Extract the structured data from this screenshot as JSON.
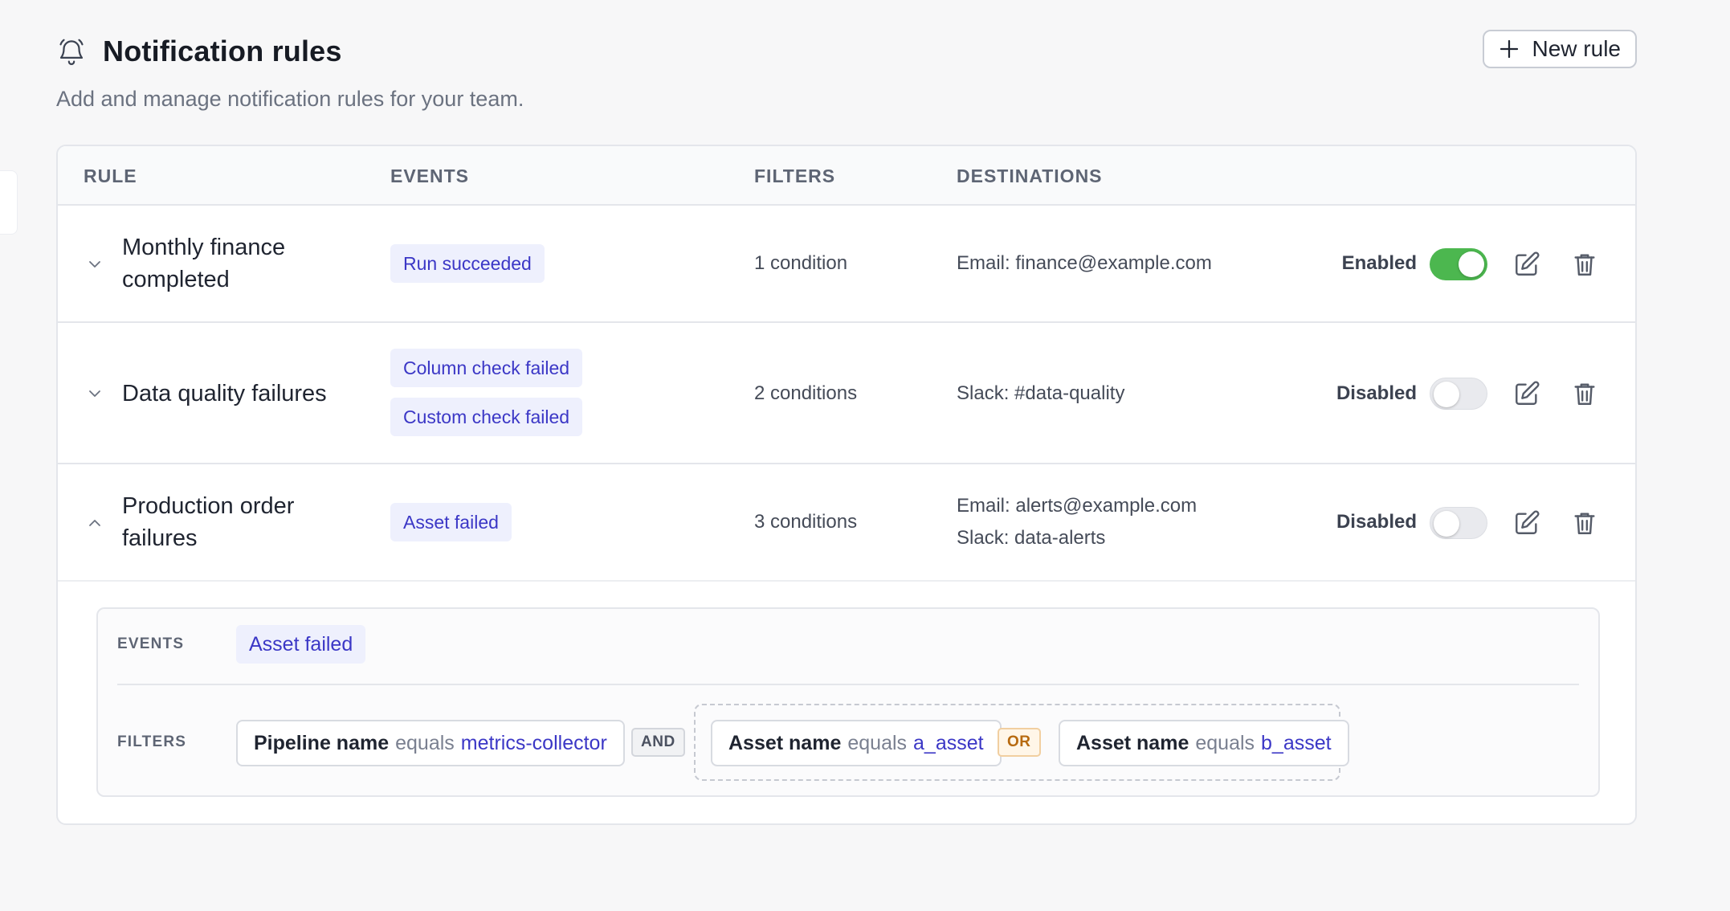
{
  "header": {
    "title": "Notification rules",
    "subtitle": "Add and manage notification rules for your team.",
    "new_rule_label": "New rule"
  },
  "table": {
    "columns": [
      "RULE",
      "EVENTS",
      "FILTERS",
      "DESTINATIONS"
    ],
    "rows": [
      {
        "name": "Monthly finance completed",
        "events": [
          "Run succeeded"
        ],
        "filters": "1 condition",
        "destinations": [
          "Email: finance@example.com"
        ],
        "status": "Enabled",
        "enabled": true,
        "expanded": false
      },
      {
        "name": "Data quality failures",
        "events": [
          "Column check failed",
          "Custom check failed"
        ],
        "filters": "2 conditions",
        "destinations": [
          "Slack: #data-quality"
        ],
        "status": "Disabled",
        "enabled": false,
        "expanded": false
      },
      {
        "name": "Production order failures",
        "events": [
          "Asset failed"
        ],
        "filters": "3 conditions",
        "destinations": [
          "Email: alerts@example.com",
          "Slack: data-alerts"
        ],
        "status": "Disabled",
        "enabled": false,
        "expanded": true
      }
    ]
  },
  "details": {
    "events_label": "EVENTS",
    "event": "Asset failed",
    "filters_label": "FILTERS",
    "conditions": [
      {
        "field": "Pipeline name",
        "op": "equals",
        "value": "metrics-collector"
      },
      {
        "field": "Asset name",
        "op": "equals",
        "value": "a_asset"
      },
      {
        "field": "Asset name",
        "op": "equals",
        "value": "b_asset"
      }
    ],
    "and_label": "AND",
    "or_label": "OR"
  },
  "colors": {
    "accent": "#3b37c6",
    "tag_bg": "#eef0fd",
    "toggle_on": "#4cb74f",
    "or_text": "#b76a10"
  },
  "icons": {
    "title": "bell-icon",
    "new_rule": "plus-icon",
    "collapse": "chevron-down-icon",
    "expand": "chevron-up-icon",
    "edit": "edit-icon",
    "delete": "trash-icon"
  }
}
